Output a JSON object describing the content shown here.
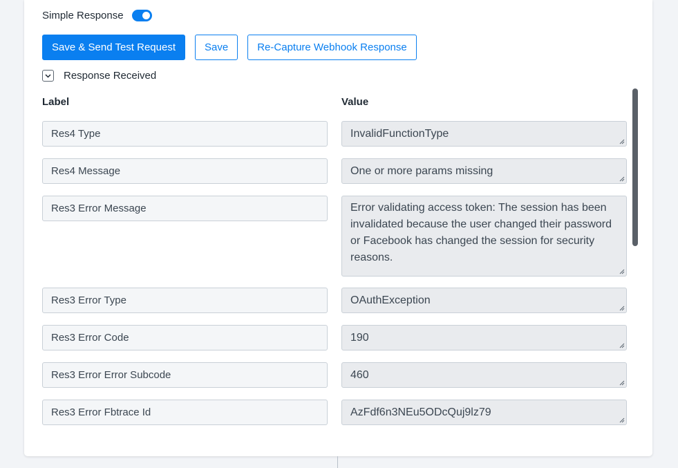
{
  "simple_response": {
    "label": "Simple Response",
    "enabled": true
  },
  "buttons": {
    "save_send": "Save & Send Test Request",
    "save": "Save",
    "recapture": "Re-Capture Webhook Response"
  },
  "response_section": {
    "label": "Response Received",
    "expanded": true
  },
  "columns": {
    "label": "Label",
    "value": "Value"
  },
  "rows": [
    {
      "label": "Res4 Type",
      "value": "InvalidFunctionType"
    },
    {
      "label": "Res4 Message",
      "value": "One or more params missing"
    },
    {
      "label": "Res3 Error Message",
      "value": "Error validating access token: The session has been invalidated because the user changed their password or Facebook has changed the session for security reasons."
    },
    {
      "label": "Res3 Error Type",
      "value": "OAuthException"
    },
    {
      "label": "Res3 Error Code",
      "value": "190"
    },
    {
      "label": "Res3 Error Error Subcode",
      "value": "460"
    },
    {
      "label": "Res3 Error Fbtrace Id",
      "value": "AzFdf6n3NEu5ODcQuj9lz79"
    }
  ],
  "colors": {
    "accent": "#0a7ff0",
    "field_bg": "#e9ebee",
    "label_bg": "#f4f6f8"
  }
}
